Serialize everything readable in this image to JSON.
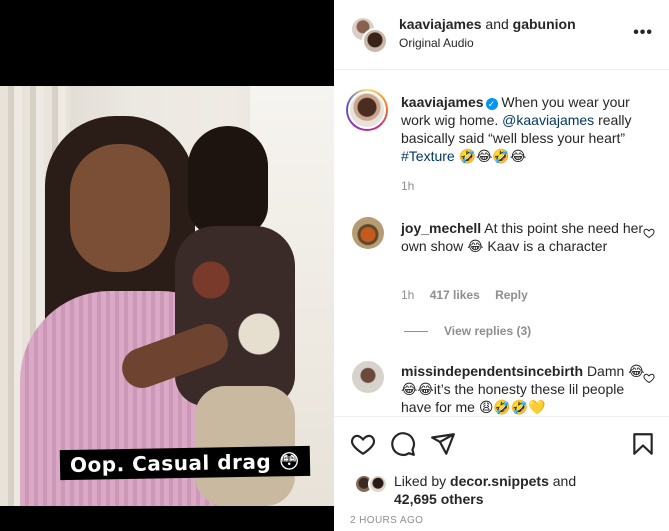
{
  "post": {
    "video_caption": "Oop. Casual drag 😳",
    "header": {
      "user1": "kaaviajames",
      "joiner": "and",
      "user2": "gabunion",
      "subtitle": "Original Audio",
      "more_label": "•••"
    },
    "caption": {
      "username": "kaaviajames",
      "verified_mark": "✓",
      "text_before": "When you wear your work wig home.",
      "mention": "@kaaviajames",
      "text_after": "really basically said “well bless your heart”",
      "hashtag": "#Texture",
      "emojis": "🤣😂🤣😂",
      "time": "1h"
    },
    "comments": [
      {
        "username": "joy_mechell",
        "text": "At this point she need her own show 😂 Kaav is a character",
        "time": "1h",
        "likes": "417 likes",
        "reply_label": "Reply",
        "view_replies": "View replies (3)"
      },
      {
        "username": "missindependentsincebirth",
        "text": "Damn 😂😂😂it’s the honesty these lil people have for me 😩🤣🤣💛"
      }
    ],
    "liked_by": {
      "prefix": "Liked by",
      "user": "decor.snippets",
      "and": "and",
      "others": "42,695 others"
    },
    "timestamp": "2 HOURS AGO"
  },
  "colors": {
    "link": "#00376b",
    "secondary_text": "#8e8e8e",
    "verified": "#0095f6"
  }
}
